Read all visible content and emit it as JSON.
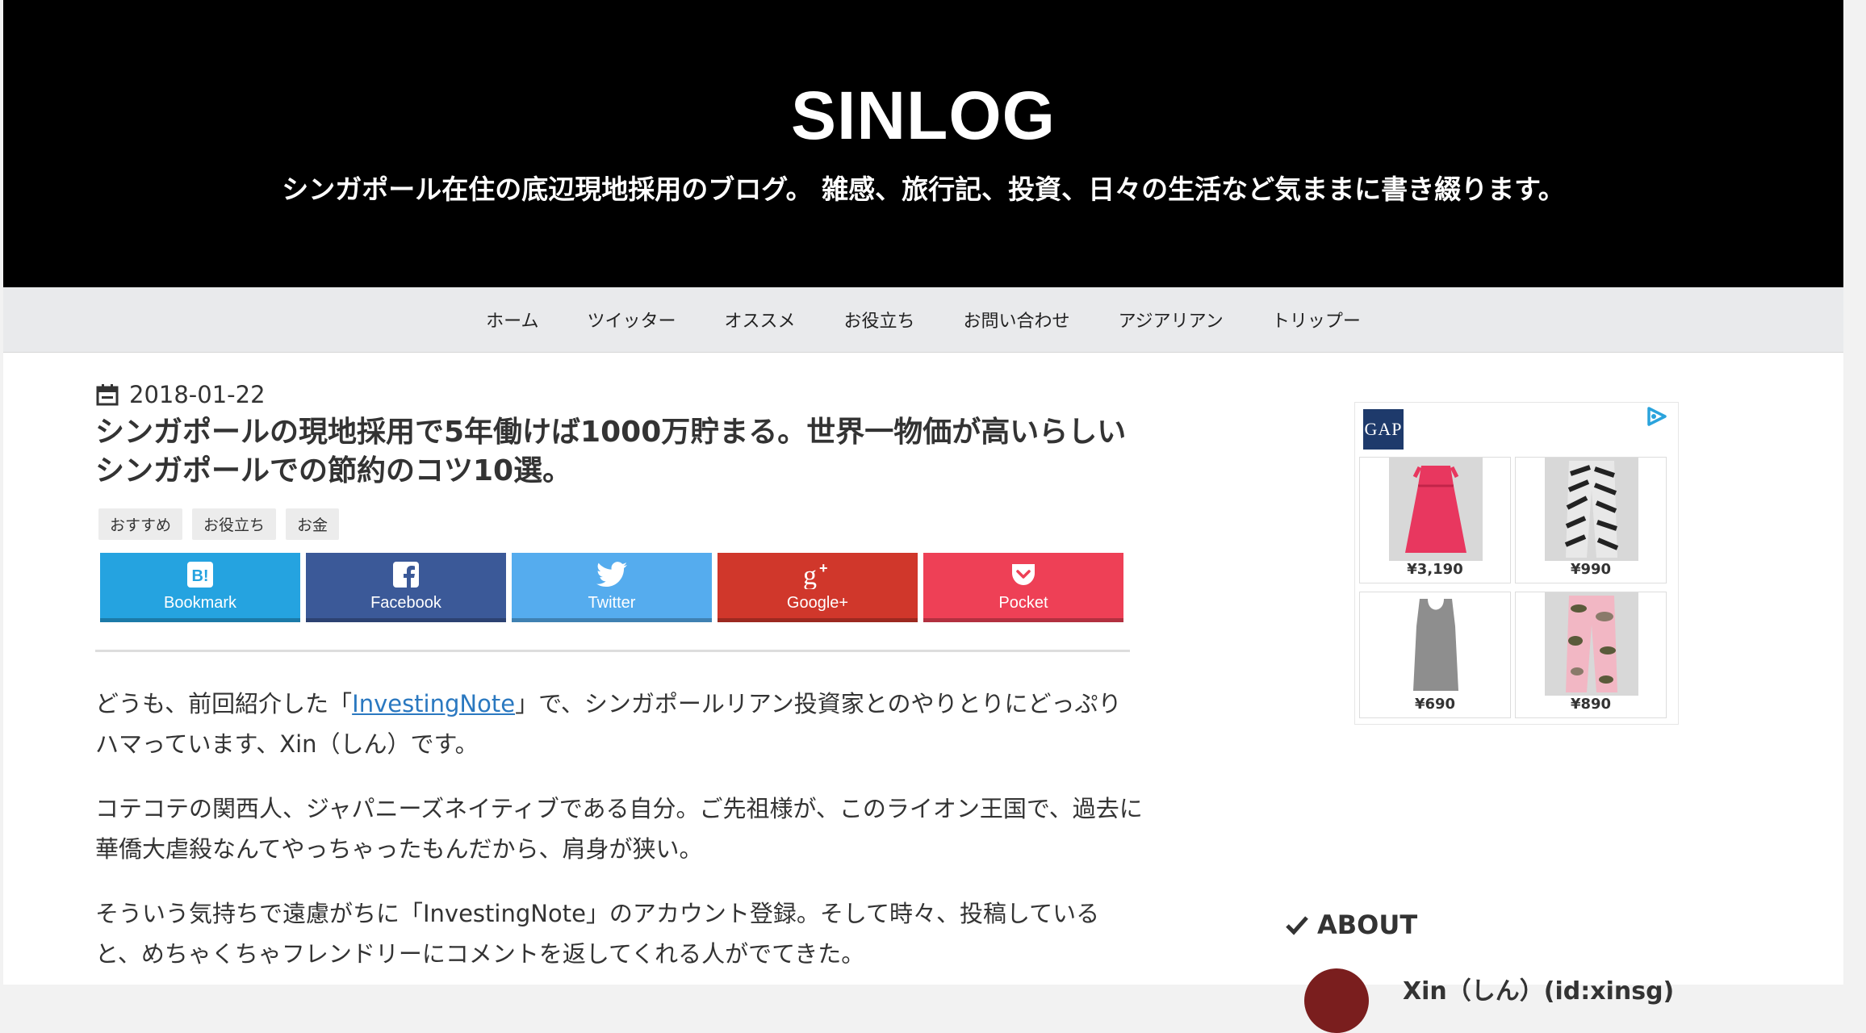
{
  "header": {
    "site_title": "SINLOG",
    "site_description": "シンガポール在住の底辺現地採用のブログ。 雑感、旅行記、投資、日々の生活など気ままに書き綴ります。"
  },
  "nav": {
    "items": [
      "ホーム",
      "ツイッター",
      "オススメ",
      "お役立ち",
      "お問い合わせ",
      "アジアリアン",
      "トリップー"
    ]
  },
  "post": {
    "date": "2018-01-22",
    "title": "シンガポールの現地採用で5年働けば1000万貯まる。世界一物価が高いらしいシンガポールでの節約のコツ10選。",
    "tags": [
      "おすすめ",
      "お役立ち",
      "お金"
    ]
  },
  "share": [
    {
      "label": "Bookmark",
      "icon": "hatena-bookmark-icon",
      "color": "#25a3e0"
    },
    {
      "label": "Facebook",
      "icon": "facebook-icon",
      "color": "#3b5998"
    },
    {
      "label": "Twitter",
      "icon": "twitter-icon",
      "color": "#55acee"
    },
    {
      "label": "Google+",
      "icon": "google-plus-icon",
      "color": "#d0372b"
    },
    {
      "label": "Pocket",
      "icon": "pocket-icon",
      "color": "#ee4056"
    }
  ],
  "paragraphs": {
    "p1_before": "どうも、前回紹介した「",
    "p1_link": "InvestingNote",
    "p1_after": "」で、シンガポールリアン投資家とのやりとりにどっぷりハマっています、Xin（しん）です。",
    "p2": "コテコテの関西人、ジャパニーズネイティブである自分。ご先祖様が、このライオン王国で、過去に華僑大虐殺なんてやっちゃったもんだから、肩身が狭い。",
    "p3": "そういう気持ちで遠慮がちに「InvestingNote」のアカウント登録。そして時々、投稿していると、めちゃくちゃフレンドリーにコメントを返してくれる人がでてきた。"
  },
  "ad": {
    "brand": "GAP",
    "items": [
      {
        "price": "¥3,190",
        "product": "pink-dress"
      },
      {
        "price": "¥990",
        "product": "zebra-leggings"
      },
      {
        "price": "¥690",
        "product": "gray-tank-top"
      },
      {
        "price": "¥890",
        "product": "camo-leggings"
      }
    ]
  },
  "sidebar": {
    "about_heading": "ABOUT",
    "profile_name": "Xin（しん）(id:xinsg)"
  },
  "colors": {
    "header_bg": "#000000",
    "nav_bg": "#e9eaec",
    "link": "#2a78c0"
  }
}
